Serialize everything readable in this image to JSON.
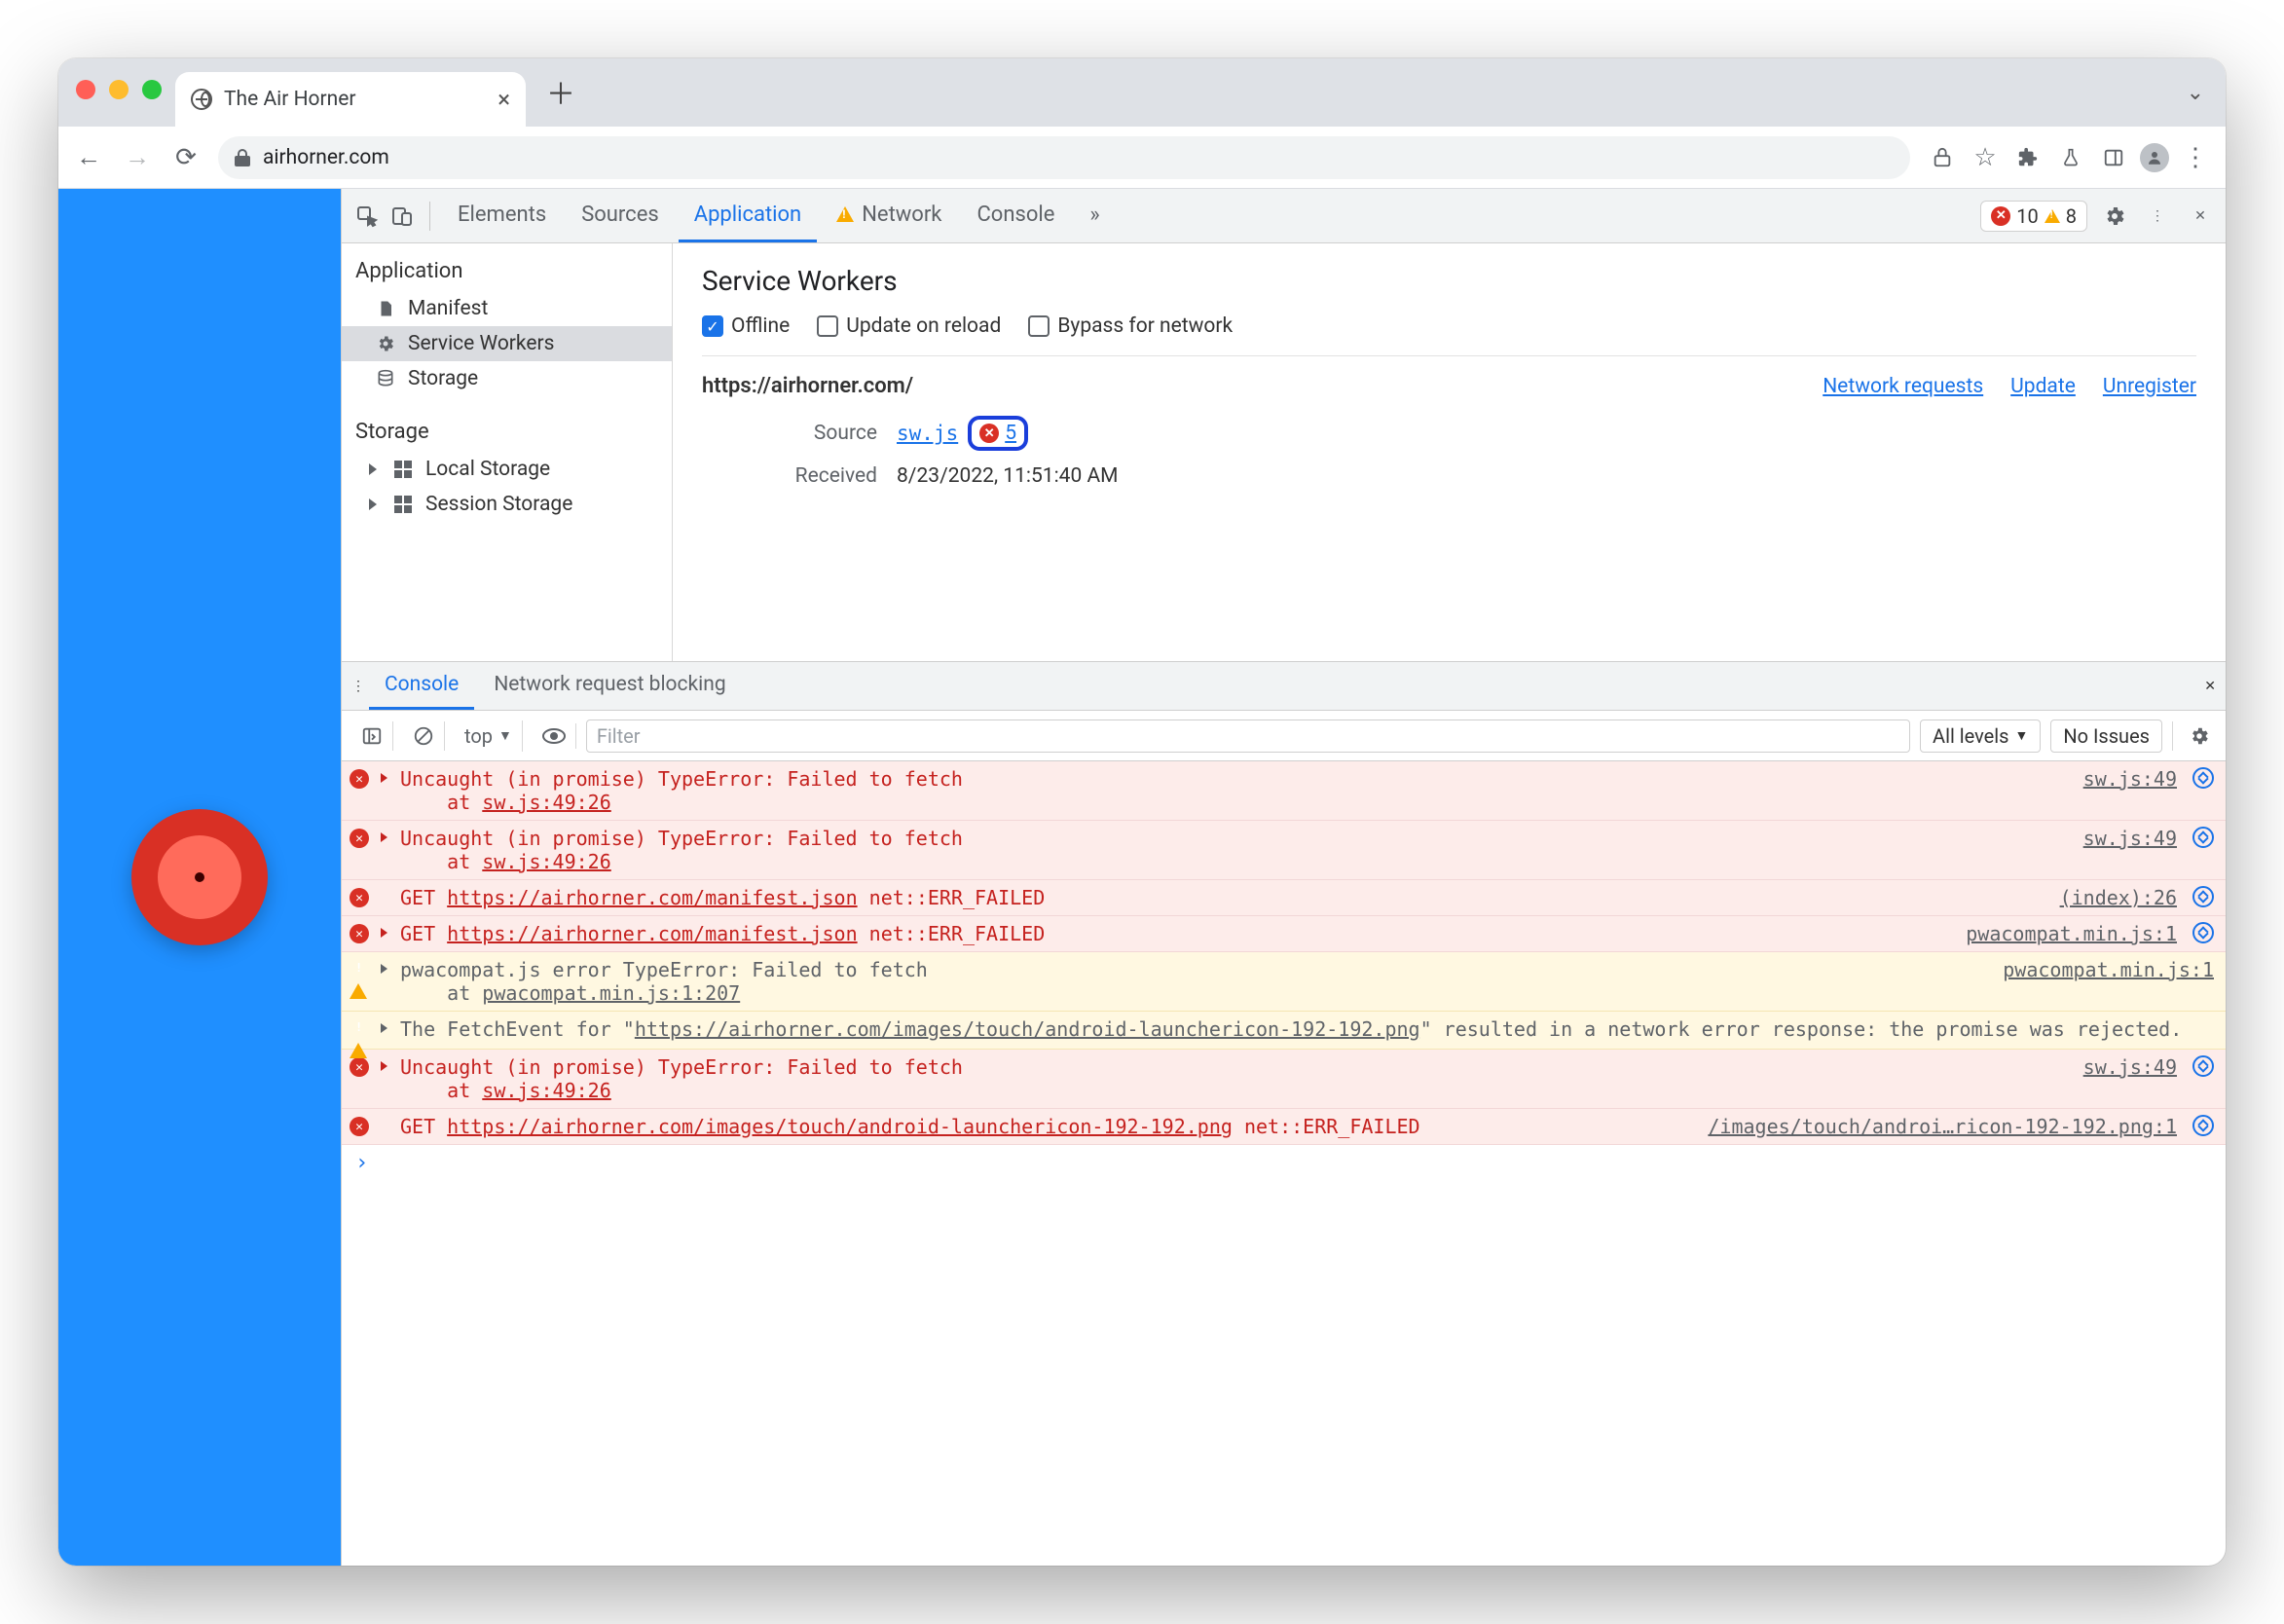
{
  "tab": {
    "title": "The Air Horner"
  },
  "omnibox": {
    "url": "airhorner.com"
  },
  "devtools": {
    "tabs": [
      "Elements",
      "Sources",
      "Application",
      "Network",
      "Console"
    ],
    "active_tab": "Application",
    "error_count": "10",
    "warning_count": "8"
  },
  "app_sidebar": {
    "section1": "Application",
    "items1": [
      "Manifest",
      "Service Workers",
      "Storage"
    ],
    "section2": "Storage",
    "items2": [
      "Local Storage",
      "Session Storage"
    ]
  },
  "service_workers": {
    "title": "Service Workers",
    "opts": {
      "offline": "Offline",
      "update": "Update on reload",
      "bypass": "Bypass for network"
    },
    "origin": "https://airhorner.com/",
    "links": {
      "net": "Network requests",
      "update": "Update",
      "unreg": "Unregister"
    },
    "source_label": "Source",
    "source_file": "sw.js",
    "source_errcount": "5",
    "received_label": "Received",
    "received_value": "8/23/2022, 11:51:40 AM"
  },
  "drawer": {
    "tabs": [
      "Console",
      "Network request blocking"
    ],
    "context": "top",
    "filter_placeholder": "Filter",
    "levels": "All levels",
    "issues": "No Issues"
  },
  "console": [
    {
      "type": "err",
      "expand": true,
      "lines": [
        "Uncaught (in promise) TypeError: Failed to fetch",
        "    at ",
        "sw.js:49:26"
      ],
      "source": "sw.js:49",
      "nav": true
    },
    {
      "type": "err",
      "expand": true,
      "lines": [
        "Uncaught (in promise) TypeError: Failed to fetch",
        "    at ",
        "sw.js:49:26"
      ],
      "source": "sw.js:49",
      "nav": true
    },
    {
      "type": "err",
      "expand": false,
      "pieces": [
        [
          "t",
          "GET "
        ],
        [
          "u",
          "https://airhorner.com/manifest.json"
        ],
        [
          "t",
          " net::ERR_FAILED"
        ]
      ],
      "source": "(index):26",
      "nav": true
    },
    {
      "type": "err",
      "expand": true,
      "pieces": [
        [
          "t",
          "GET "
        ],
        [
          "u",
          "https://airhorner.com/manifest.json"
        ],
        [
          "t",
          " net::ERR_FAILED"
        ]
      ],
      "source": "pwacompat.min.js:1",
      "nav": true
    },
    {
      "type": "warn",
      "expand": true,
      "lines": [
        "pwacompat.js error TypeError: Failed to fetch",
        "    at ",
        "pwacompat.min.js:1:207"
      ],
      "source": "pwacompat.min.js:1",
      "nav": false
    },
    {
      "type": "warn",
      "expand": true,
      "pieces": [
        [
          "t",
          "The FetchEvent for \""
        ],
        [
          "u",
          "https://airhorner.com/images/touch/android-launchericon-192-192.png"
        ],
        [
          "t",
          "\" resulted in a network error response: the promise was rejected."
        ]
      ],
      "source": "",
      "nav": false
    },
    {
      "type": "err",
      "expand": true,
      "lines": [
        "Uncaught (in promise) TypeError: Failed to fetch",
        "    at ",
        "sw.js:49:26"
      ],
      "source": "sw.js:49",
      "nav": true
    },
    {
      "type": "err",
      "expand": false,
      "pieces": [
        [
          "t",
          "GET "
        ],
        [
          "u",
          "https://airhorner.com/images/touch/android-launchericon-192-192.png"
        ],
        [
          "t",
          " net::ERR_FAILED"
        ]
      ],
      "source": "/images/touch/androi…ricon-192-192.png:1",
      "nav": true
    }
  ]
}
